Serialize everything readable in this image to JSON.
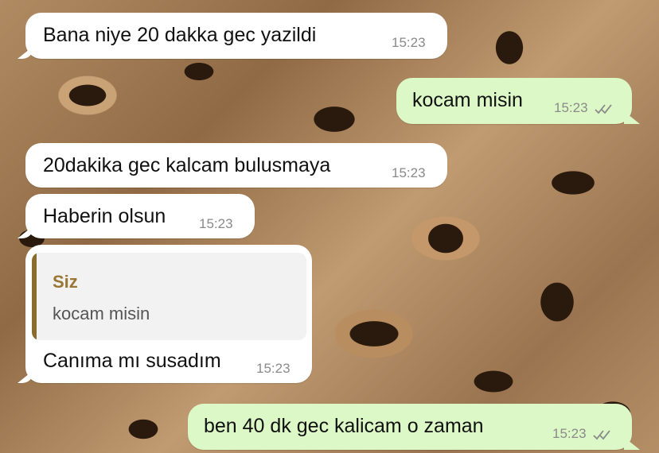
{
  "chat": {
    "messages": [
      {
        "direction": "incoming",
        "text": "Bana niye 20 dakka gec yazildi",
        "time": "15:23"
      },
      {
        "direction": "outgoing",
        "text": "kocam misin",
        "time": "15:23",
        "status": "read"
      },
      {
        "direction": "incoming",
        "text": "20dakika gec kalcam bulusmaya",
        "time": "15:23"
      },
      {
        "direction": "incoming",
        "text": "Haberin olsun",
        "time": "15:23"
      },
      {
        "direction": "incoming",
        "text": "Canıma mı susadım",
        "time": "15:23",
        "reply_to": {
          "author": "Siz",
          "text": "kocam misin"
        }
      },
      {
        "direction": "outgoing",
        "text": "ben 40 dk gec kalicam o zaman",
        "time": "15:23",
        "status": "read"
      }
    ]
  },
  "colors": {
    "incoming_bubble": "#ffffff",
    "outgoing_bubble": "#dcf8c6",
    "reply_accent": "#9b7533",
    "timestamp": "#8a8a8a"
  },
  "icons": {
    "read_receipt": "double-check-icon"
  }
}
